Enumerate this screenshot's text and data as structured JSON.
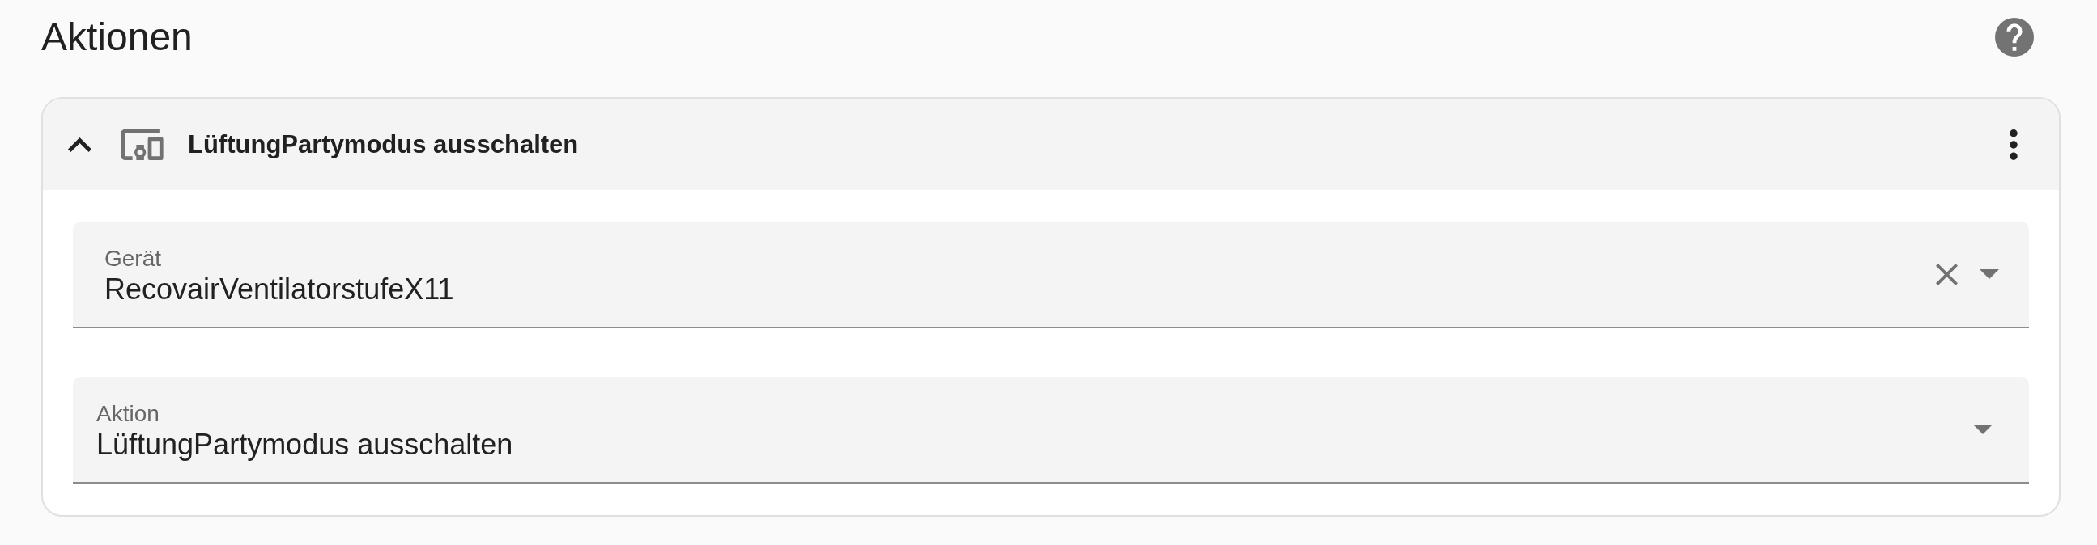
{
  "page": {
    "title": "Aktionen"
  },
  "action_card": {
    "expanded": true,
    "title": "LüftungPartymodus ausschalten",
    "fields": [
      {
        "kind": "combobox",
        "label": "Gerät",
        "value": "RecovairVentilatorstufeX11",
        "clearable": true
      },
      {
        "kind": "select",
        "label": "Aktion",
        "value": "LüftungPartymodus ausschalten",
        "clearable": false
      }
    ]
  }
}
